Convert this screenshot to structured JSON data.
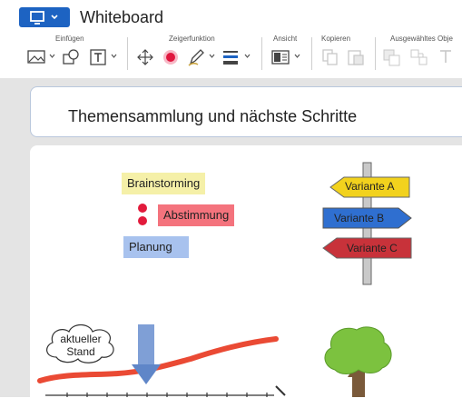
{
  "app": {
    "title": "Whiteboard"
  },
  "ribbon": {
    "groups": [
      {
        "label": "Einfügen"
      },
      {
        "label": "Zeigerfunktion"
      },
      {
        "label": "Ansicht"
      },
      {
        "label": "Kopieren"
      },
      {
        "label": "Ausgewähltes Obje"
      }
    ]
  },
  "board": {
    "title": "Themensammlung und nächste Schritte",
    "notes": {
      "brainstorming": "Brainstorming",
      "abstimmung": "Abstimmung",
      "planung": "Planung"
    },
    "signpost": {
      "a": "Variante A",
      "b": "Variante B",
      "c": "Variante C"
    },
    "cloud": {
      "line1": "aktueller",
      "line2": "Stand"
    }
  },
  "colors": {
    "accent": "#1d63c2",
    "note_yellow": "#f5f0a8",
    "note_red": "#f4737d",
    "note_blue": "#a8c2ee",
    "arrow_yellow": "#f2d21d",
    "arrow_blue": "#2f6fd0",
    "arrow_red": "#c8323a",
    "curve_red": "#ea4a34",
    "arrow_down": "#7f9fd6",
    "tree_green": "#7cc23f",
    "trunk": "#7a5a3a"
  },
  "icons": [
    "monitor-icon",
    "image-icon",
    "shapes-icon",
    "text-icon",
    "move-icon",
    "laser-pointer-icon",
    "pen-icon",
    "line-style-icon",
    "view-icon",
    "copy-icon",
    "paste-icon",
    "bring-forward-icon",
    "group-icon",
    "text-format-icon"
  ]
}
